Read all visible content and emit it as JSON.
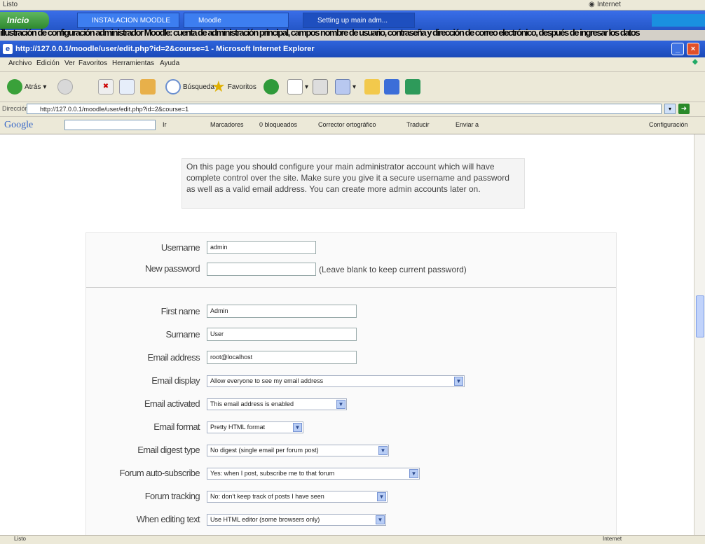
{
  "background_window": {
    "status_left": "Listo",
    "status_right": "Internet"
  },
  "taskbar": {
    "start_label": "Inicio",
    "buttons": [
      "INSTALACION MOODLE",
      "Moodle",
      "Setting up main adm..."
    ]
  },
  "overlay_text": "illustración de configuración administrador Moodle: cuenta de administración principal, campos nombre de usuario, contraseña y dirección de correo electrónico, después de ingresar los datos",
  "window": {
    "title": "http://127.0.0.1/moodle/user/edit.php?id=2&course=1 - Microsoft Internet Explorer"
  },
  "menu": [
    "Archivo",
    "Edición",
    "Ver",
    "Favoritos",
    "Herramientas",
    "Ayuda"
  ],
  "toolbar": {
    "back": "Atrás",
    "search": "Búsqueda",
    "favorites": "Favoritos"
  },
  "address": {
    "label": "Dirección",
    "value": "http://127.0.0.1/moodle/user/edit.php?id=2&course=1"
  },
  "google_bar": {
    "logo": "Google",
    "items": [
      "Ir",
      "Marcadores",
      "0 bloqueados",
      "Corrector ortográfico",
      "Traducir",
      "Enviar a"
    ],
    "settings": "Configuración"
  },
  "info": "On this page you should configure your main administrator account which will have complete control over the site. Make sure you give it a secure username and password as well as a valid email address. You can create more admin accounts later on.",
  "form": {
    "username_label": "Username",
    "username_value": "admin",
    "new_password_label": "New password",
    "new_password_hint": "(Leave blank to keep current password)",
    "first_name_label": "First name",
    "first_name_value": "Admin",
    "surname_label": "Surname",
    "surname_value": "User",
    "email_label": "Email address",
    "email_value": "root@localhost",
    "email_display_label": "Email display",
    "email_display_value": "Allow everyone to see my email address",
    "email_activated_label": "Email activated",
    "email_activated_value": "This email address is enabled",
    "email_format_label": "Email format",
    "email_format_value": "Pretty HTML format",
    "digest_label": "Email digest type",
    "digest_value": "No digest (single email per forum post)",
    "autosub_label": "Forum auto-subscribe",
    "autosub_value": "Yes: when I post, subscribe me to that forum",
    "tracking_label": "Forum tracking",
    "tracking_value": "No: don't keep track of posts I have seen",
    "editing_label": "When editing text",
    "editing_value": "Use HTML editor (some browsers only)"
  },
  "statusbar": {
    "left": "Listo",
    "right": "Internet"
  }
}
